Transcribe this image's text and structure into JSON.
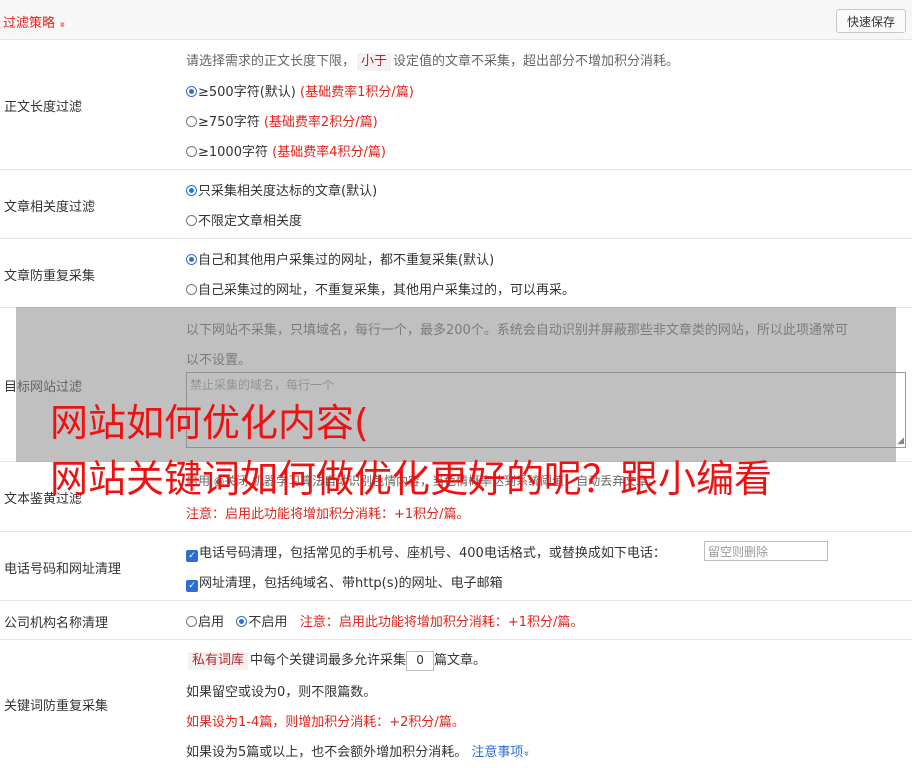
{
  "header": {
    "title": "过滤策略",
    "chevron": "»",
    "save_label": "快速保存"
  },
  "length_filter": {
    "label": "正文长度过滤",
    "desc_prefix": "请选择需求的正文长度下限，",
    "desc_tag": "小于",
    "desc_suffix": "设定值的文章不采集，超出部分不增加积分消耗。",
    "options": [
      {
        "text": "≥500字符(默认)",
        "note": "(基础费率1积分/篇)",
        "selected": true
      },
      {
        "text": "≥750字符",
        "note": "(基础费率2积分/篇)",
        "selected": false
      },
      {
        "text": "≥1000字符",
        "note": "(基础费率4积分/篇)",
        "selected": false
      }
    ]
  },
  "relevance": {
    "label": "文章相关度过滤",
    "options": [
      {
        "text": "只采集相关度达标的文章(默认)",
        "selected": true
      },
      {
        "text": "不限定文章相关度",
        "selected": false
      }
    ]
  },
  "dedupe": {
    "label": "文章防重复采集",
    "options": [
      {
        "text": "自己和其他用户采集过的网址，都不重复采集(默认)",
        "selected": true
      },
      {
        "text": "自己采集过的网址，不重复采集，其他用户采集过的，可以再采。",
        "selected": false
      }
    ]
  },
  "target_site": {
    "label": "目标网站过滤",
    "desc_line1": "以下网站不采集，只填域名，每行一个，最多200个。系统会自动识别并屏蔽那些非文章类的网站，所以此项通常可",
    "desc_line2": "以不设置。",
    "placeholder": "禁止采集的域名，每行一个"
  },
  "porn": {
    "label": "文本鉴黄过滤",
    "line": "启用  ◉关闭  机器学习算法自动识别色情内容，当色情概率达到系统阈值，自动丢弃文章。",
    "note": "注意：启用此功能将增加积分消耗：+1积分/篇。"
  },
  "phone": {
    "label": "电话号码和网址清理",
    "phone_text": "电话号码清理，包括常见的手机号、座机号、400电话格式，或替换成如下电话：",
    "phone_placeholder": "留空则删除",
    "url_text": "网址清理，包括纯域名、带http(s)的网址、电子邮箱"
  },
  "company": {
    "label": "公司机构名称清理",
    "enable": "启用",
    "disable": "不启用",
    "note": "注意：启用此功能将增加积分消耗：+1积分/篇。",
    "enabled": false
  },
  "keyword_dedupe": {
    "label": "关键词防重复采集",
    "tag": "私有词库",
    "text_a": "中每个关键词最多允许采集",
    "value": "0",
    "text_b": "篇文章。",
    "line2": "如果留空或设为0，则不限篇数。",
    "line3": "如果设为1-4篇，则增加积分消耗：+2积分/篇。",
    "line4": "如果设为5篇或以上，也不会额外增加积分消耗。",
    "notice_link": "注意事项",
    "notice_chevron": "»"
  },
  "overlay": {
    "line1": "网站如何优化内容(",
    "line2": "网站关键词如何做优化更好的呢？跟小编看"
  },
  "colors": {
    "accent_red": "#e0241b",
    "link_blue": "#2b6fd6",
    "overlay_gray": "#8c8c8c"
  }
}
